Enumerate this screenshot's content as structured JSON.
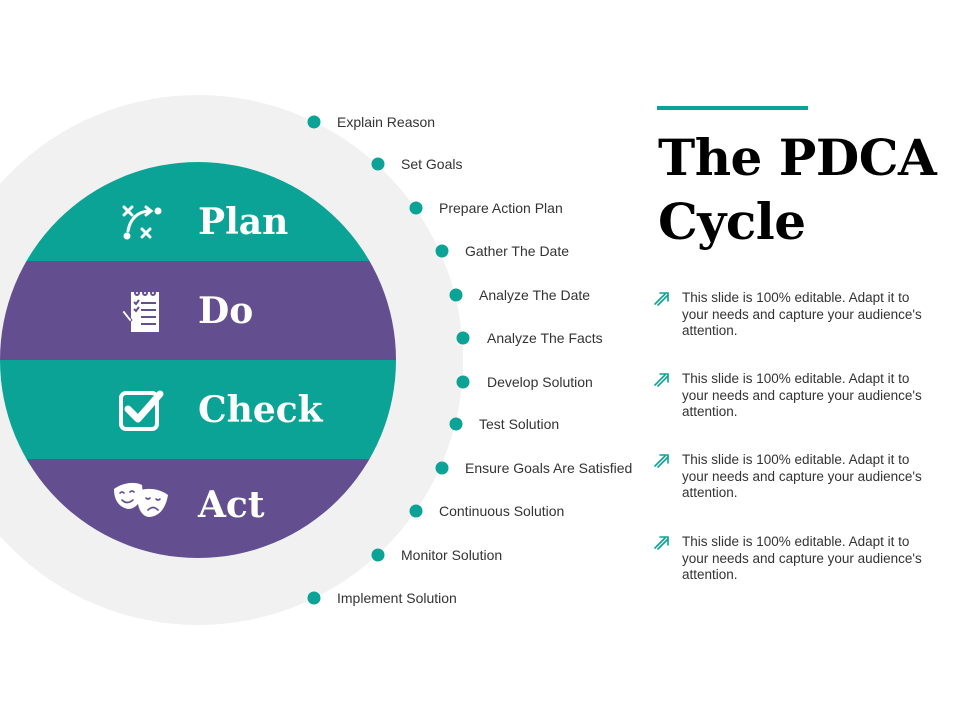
{
  "colors": {
    "teal": "#0ba395",
    "purple": "#634f8f",
    "ring": "#f1f1f1",
    "text": "#333333"
  },
  "title": {
    "line1": "The PDCA",
    "line2": "Cycle"
  },
  "phases": [
    {
      "label": "Plan",
      "icon": "strategy-icon"
    },
    {
      "label": "Do",
      "icon": "checklist-notepad-icon"
    },
    {
      "label": "Check",
      "icon": "checkbox-checked-icon"
    },
    {
      "label": "Act",
      "icon": "theater-masks-icon"
    }
  ],
  "steps": [
    "Explain Reason",
    "Set Goals",
    "Prepare Action Plan",
    "Gather The Date",
    "Analyze The Date",
    "Analyze The Facts",
    "Develop Solution",
    "Test Solution",
    "Ensure Goals Are Satisfied",
    "Continuous Solution",
    "Monitor Solution",
    "Implement Solution"
  ],
  "notes": [
    {
      "icon": "double-arrow-up-right-icon",
      "text": "This slide is 100% editable. Adapt it to your needs and capture your audience's attention."
    },
    {
      "icon": "double-arrow-up-right-icon",
      "text": "This slide is 100% editable. Adapt it to your needs and capture your audience's attention."
    },
    {
      "icon": "double-arrow-up-right-icon",
      "text": "This slide is 100% editable. Adapt it to your needs and capture your audience's attention."
    },
    {
      "icon": "double-arrow-up-right-icon",
      "text": "This slide is 100% editable. Adapt it to your needs and capture your audience's attention."
    }
  ]
}
